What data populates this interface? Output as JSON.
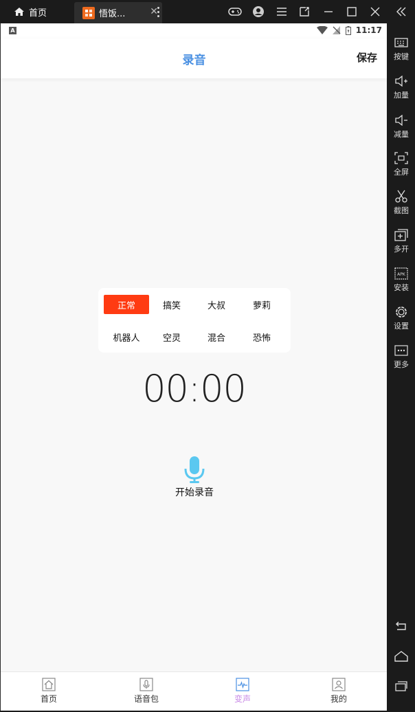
{
  "window": {
    "home_tab_label": "首页",
    "app_tab_label": "悟饭...",
    "tab_close": "✕"
  },
  "statusbar": {
    "indicator": "A",
    "time": "11:17"
  },
  "header": {
    "title": "录音",
    "save_label": "保存"
  },
  "effects": [
    {
      "label": "正常",
      "active": true
    },
    {
      "label": "搞笑",
      "active": false
    },
    {
      "label": "大叔",
      "active": false
    },
    {
      "label": "萝莉",
      "active": false
    },
    {
      "label": "机器人",
      "active": false
    },
    {
      "label": "空灵",
      "active": false
    },
    {
      "label": "混合",
      "active": false
    },
    {
      "label": "恐怖",
      "active": false
    }
  ],
  "timer": "00:00",
  "record": {
    "label": "开始录音"
  },
  "bottom_nav": [
    {
      "label": "首页",
      "icon": "home-icon",
      "active": false
    },
    {
      "label": "语音包",
      "icon": "mic-icon",
      "active": false
    },
    {
      "label": "变声",
      "icon": "waveform-icon",
      "active": true
    },
    {
      "label": "我的",
      "icon": "user-icon",
      "active": false
    }
  ],
  "sidebar": {
    "keys": "按键",
    "vol_up": "加量",
    "vol_down": "减量",
    "fullscreen": "全屏",
    "screenshot": "截图",
    "multi": "多开",
    "install": "安装",
    "settings": "设置",
    "more": "更多"
  },
  "colors": {
    "accent": "#4a90e2",
    "effect_active": "#ff3b12",
    "nav_active": "#c98be6",
    "mic": "#5bc8f0"
  }
}
